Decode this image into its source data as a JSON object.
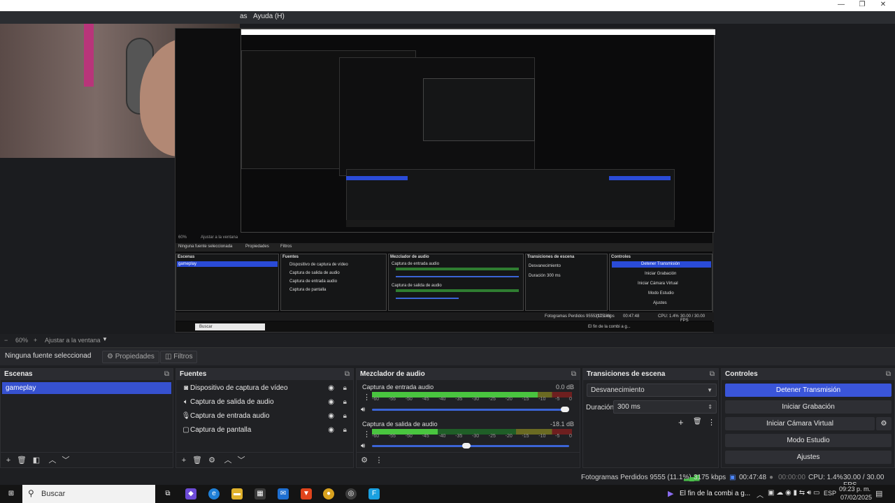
{
  "menubar": {
    "items": [
      "as",
      "Ayuda (H)"
    ]
  },
  "preview": {
    "nested": {
      "zoom_label": "60%",
      "fit_label": "Ajustar a la ventana",
      "no_source": "Ninguna fuente seleccionada",
      "properties": "Propiedades",
      "filters": "Filtros",
      "docks": [
        "Escenas",
        "Fuentes",
        "Mezclador de audio",
        "Transiciones de escena",
        "Controles"
      ],
      "scene": "gameplay",
      "sources": [
        "Dispositivo de captura de vídeo",
        "Captura de salida de audio",
        "Captura de entrada audio",
        "Captura de pantalla"
      ],
      "mixer": [
        "Captura de entrada audio",
        "Captura de salida de audio"
      ],
      "transition": "Desvanecimiento",
      "duration_label": "Duración",
      "duration": "300 ms",
      "controls": [
        "Detener Transmisión",
        "Iniciar Grabación",
        "Iniciar Cámara Virtual",
        "Modo Estudio",
        "Ajustes"
      ],
      "status": "Fotogramas Perdidos 9555 (11.1%)",
      "bitrate": "3175 kbps",
      "time": "00:47:48",
      "cpu": "CPU: 1.4%",
      "fps": "30.00 / 30.00 FPS",
      "search": "Buscar",
      "task_title": "El fin de la combi a g..."
    }
  },
  "zoombar": {
    "zoom": "60%",
    "fit": "Ajustar a la ventana"
  },
  "propbar": {
    "no_source": "Ninguna fuente seleccionad",
    "properties": "Propiedades",
    "filters": "Filtros"
  },
  "scenes": {
    "title": "Escenas",
    "items": [
      "gameplay"
    ]
  },
  "sources": {
    "title": "Fuentes",
    "items": [
      {
        "label": "Dispositivo de captura de vídeo",
        "icon": "camera-icon"
      },
      {
        "label": "Captura de salida de audio",
        "icon": "speaker-icon"
      },
      {
        "label": "Captura de entrada audio",
        "icon": "microphone-icon"
      },
      {
        "label": "Captura de pantalla",
        "icon": "monitor-icon"
      }
    ]
  },
  "mixer": {
    "title": "Mezclador de audio",
    "channels": [
      {
        "name": "Captura de entrada audio",
        "db": "0.0 dB",
        "level": 0.83,
        "volume": 1.0
      },
      {
        "name": "Captura de salida de audio",
        "db": "-18.1 dB",
        "level": 0.33,
        "volume": 0.5
      }
    ],
    "ticks": [
      "-60",
      "-55",
      "-50",
      "-45",
      "-40",
      "-35",
      "-30",
      "-25",
      "-20",
      "-15",
      "-10",
      "-5",
      "0"
    ]
  },
  "transitions": {
    "title": "Transiciones de escena",
    "selected": "Desvanecimiento",
    "duration_label": "Duración",
    "duration": "300 ms"
  },
  "controls": {
    "title": "Controles",
    "stop_stream": "Detener Transmisión",
    "start_recording": "Iniciar Grabación",
    "start_virtual_cam": "Iniciar Cámara Virtual",
    "studio_mode": "Modo Estudio",
    "settings": "Ajustes"
  },
  "statusbar": {
    "dropped": "Fotogramas Perdidos 9555 (11.1%)",
    "bitrate": "3175 kbps",
    "stream_time": "00:47:48",
    "rec_time": "00:00:00",
    "cpu": "CPU: 1.4%",
    "fps": "30.00 / 30.00 FPS"
  },
  "taskbar": {
    "search": "Buscar",
    "media_title": "El fin de la combi a g...",
    "lang": "ESP",
    "time": "09:23 p. m.",
    "date": "07/02/2025"
  },
  "colors": {
    "accent": "#3a55d9",
    "meter_green": "#49c53f",
    "background": "#1e1f22"
  }
}
